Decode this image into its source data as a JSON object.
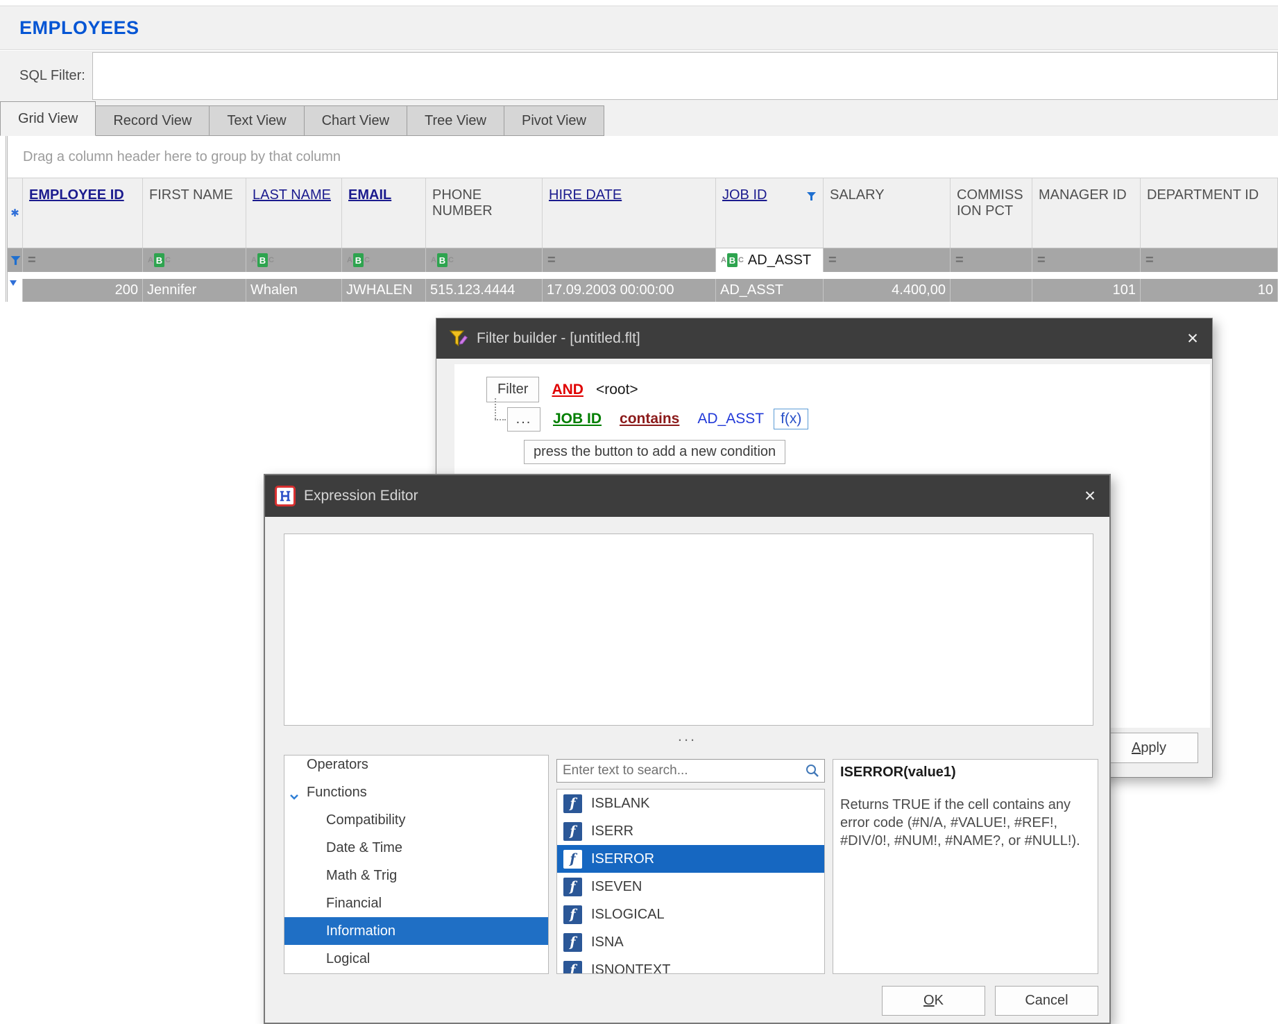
{
  "page": {
    "title": "EMPLOYEES"
  },
  "sql_filter": {
    "label": "SQL Filter:",
    "value": ""
  },
  "tabs": [
    {
      "label": "Grid View",
      "active": true
    },
    {
      "label": "Record View",
      "active": false
    },
    {
      "label": "Text View",
      "active": false
    },
    {
      "label": "Chart View",
      "active": false
    },
    {
      "label": "Tree View",
      "active": false
    },
    {
      "label": "Pivot View",
      "active": false
    }
  ],
  "grid": {
    "group_hint": "Drag a column header here to group by that column",
    "icons": {
      "new_row_glyph": "✱",
      "equals_glyph": "=",
      "abc_a": "A",
      "abc_b": "B",
      "abc_c": "C"
    },
    "columns": [
      {
        "label": "EMPLOYEE ID",
        "filter_icon": "equals-icon"
      },
      {
        "label": "FIRST NAME",
        "filter_icon": "abc-icon"
      },
      {
        "label": "LAST NAME",
        "filter_icon": "abc-icon"
      },
      {
        "label": "EMAIL",
        "filter_icon": "abc-icon"
      },
      {
        "label": "PHONE NUMBER",
        "filter_icon": "abc-icon"
      },
      {
        "label": "HIRE DATE",
        "filter_icon": "equals-icon"
      },
      {
        "label": "JOB ID",
        "filter_icon": "abc-icon",
        "filtered": true,
        "filter_value": "AD_ASST"
      },
      {
        "label": "SALARY",
        "filter_icon": "equals-icon"
      },
      {
        "label": "COMMISSION PCT",
        "filter_icon": "equals-icon"
      },
      {
        "label": "MANAGER ID",
        "filter_icon": "equals-icon"
      },
      {
        "label": "DEPARTMENT ID",
        "filter_icon": "equals-icon"
      }
    ],
    "row": [
      "200",
      "Jennifer",
      "Whalen",
      "JWHALEN",
      "515.123.4444",
      "17.09.2003 00:00:00",
      "AD_ASST",
      "4.400,00",
      "",
      "101",
      "10"
    ]
  },
  "filter_builder": {
    "title": "Filter builder - [untitled.flt]",
    "close_glyph": "✕",
    "group_button": "Filter",
    "group_operator": "AND",
    "root_label": "<root>",
    "condition": {
      "menu_glyph": "...",
      "field": "JOB ID",
      "operator": "contains",
      "value": "AD_ASST",
      "fx_label": "f(x)"
    },
    "add_condition_hint": "press the button to add a new condition",
    "apply": {
      "first": "A",
      "rest": "pply"
    }
  },
  "expression_editor": {
    "title": "Expression Editor",
    "close_glyph": "✕",
    "expression_value": "",
    "splitter_glyph": "...",
    "tree": [
      {
        "label": "Operators",
        "selected": false
      },
      {
        "label": "Functions",
        "selected": false,
        "expanded": true
      },
      {
        "label": "Compatibility",
        "selected": false
      },
      {
        "label": "Date & Time",
        "selected": false
      },
      {
        "label": "Math & Trig",
        "selected": false
      },
      {
        "label": "Financial",
        "selected": false
      },
      {
        "label": "Information",
        "selected": true
      },
      {
        "label": "Logical",
        "selected": false
      }
    ],
    "search_placeholder": "Enter text to search...",
    "functions": [
      {
        "name": "ISBLANK",
        "selected": false
      },
      {
        "name": "ISERR",
        "selected": false
      },
      {
        "name": "ISERROR",
        "selected": true
      },
      {
        "name": "ISEVEN",
        "selected": false
      },
      {
        "name": "ISLOGICAL",
        "selected": false
      },
      {
        "name": "ISNA",
        "selected": false
      },
      {
        "name": "ISNONTEXT",
        "selected": false
      }
    ],
    "info": {
      "signature": "ISERROR(value1)",
      "description": "Returns TRUE if the cell contains any error code (#N/A, #VALUE!, #REF!, #DIV/0!, #NUM!, #NAME?, or #NULL!)."
    },
    "ok": {
      "first": "O",
      "rest": "K"
    },
    "cancel_label": "Cancel"
  },
  "colors": {
    "title_blue": "#0455d4",
    "selection_blue": "#1f6fc5",
    "dialog_titlebar": "#3d3d3d",
    "grid_row_gray": "#a6a6a6",
    "and_red": "#e00000",
    "field_green": "#007e00",
    "operator_maroon": "#8b1a1a",
    "value_blue": "#2038d8",
    "function_icon_blue": "#2b5797",
    "abc_green": "#2ea44f"
  }
}
